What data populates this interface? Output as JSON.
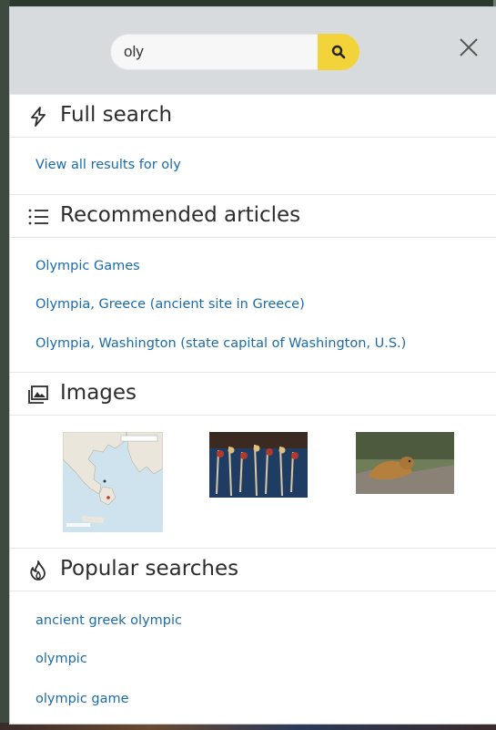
{
  "search": {
    "value": "oly",
    "search_icon": "magnifier-icon",
    "close_icon": "close-icon",
    "accent": "#f2d33a"
  },
  "full_search": {
    "title": "Full search",
    "icon": "lightning-icon",
    "link": "View all results for oly"
  },
  "recommended": {
    "title": "Recommended articles",
    "icon": "list-icon",
    "items": [
      "Olympic Games",
      "Olympia, Greece (ancient site in Greece)",
      "Olympia, Washington (state capital of Washington, U.S.)"
    ]
  },
  "images": {
    "title": "Images",
    "icon": "images-icon",
    "items": [
      "map-of-greece-image",
      "historical-figures-image",
      "marmot-image"
    ]
  },
  "popular": {
    "title": "Popular searches",
    "icon": "flame-icon",
    "items": [
      "ancient greek olympic",
      "olympic",
      "olympic game"
    ]
  },
  "colors": {
    "link": "#1a6ba8",
    "header_bg": "#d7dbde"
  }
}
